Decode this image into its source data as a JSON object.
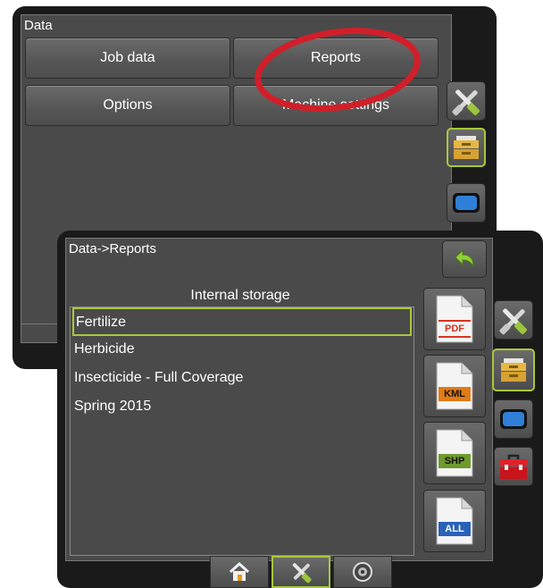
{
  "back_window": {
    "title": "Data",
    "buttons": {
      "job_data": "Job data",
      "reports": "Reports",
      "options": "Options",
      "machine_settings": "Machine settings"
    }
  },
  "front_window": {
    "title": "Data->Reports",
    "storage_label": "Internal storage",
    "items": [
      "Fertilize",
      "Herbicide",
      "Insecticide - Full Coverage",
      "Spring 2015"
    ],
    "selected_index": 0,
    "export_buttons": [
      {
        "label": "PDF",
        "color": "#d9331f"
      },
      {
        "label": "KML",
        "color": "#e07b17"
      },
      {
        "label": "SHP",
        "color": "#6f9a2e"
      },
      {
        "label": "ALL",
        "color": "#2a62b8"
      }
    ]
  },
  "colors": {
    "accent": "#a7c83a",
    "annotation_circle": "#d01f2a",
    "background": "#4a4a4a"
  },
  "icons": {
    "tools": "tools-icon",
    "data": "file-cabinet-icon",
    "display": "display-icon",
    "toolbox": "toolbox-icon",
    "back": "back-arrow-icon",
    "home": "home-icon",
    "guidance": "guidance-icon"
  }
}
